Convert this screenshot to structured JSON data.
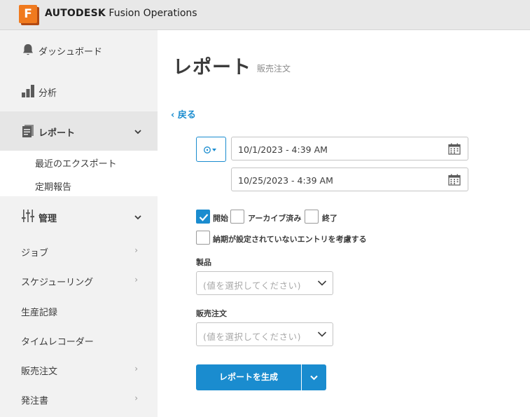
{
  "app": {
    "logo_letter": "F",
    "brand_bold": "AUTODESK",
    "brand_rest": " Fusion Operations",
    "accent_color": "#1a8ccf",
    "logo_color": "#f07a1e"
  },
  "sidebar": {
    "dashboard": "ダッシュボード",
    "analytics": "分析",
    "reports": "レポート",
    "reports_sub": [
      "最近のエクスポート",
      "定期報告"
    ],
    "management": "管理",
    "items": [
      {
        "label": "ジョブ",
        "has_arrow": true
      },
      {
        "label": "スケジューリング",
        "has_arrow": true
      },
      {
        "label": "生産記録",
        "has_arrow": false
      },
      {
        "label": "タイムレコーダー",
        "has_arrow": false
      },
      {
        "label": "販売注文",
        "has_arrow": true
      },
      {
        "label": "発注書",
        "has_arrow": true
      }
    ],
    "arrow_glyph": "›"
  },
  "main": {
    "title": "レポート",
    "subtitle": "販売注文",
    "back": "‹ 戻る",
    "date_from": "10/1/2023 - 4:39 AM",
    "date_to": "10/25/2023 - 4:39 AM",
    "status_filters": [
      {
        "label": "開始",
        "checked": true
      },
      {
        "label": "アーカイブ済み",
        "checked": false
      },
      {
        "label": "終了",
        "checked": false
      }
    ],
    "no_due_date_label": "納期が設定されていないエントリを考慮する",
    "product_label": "製品",
    "product_placeholder": "(値を選択してください)",
    "sales_order_label": "販売注文",
    "sales_order_placeholder": "(値を選択してください)",
    "generate_button": "レポートを生成"
  }
}
